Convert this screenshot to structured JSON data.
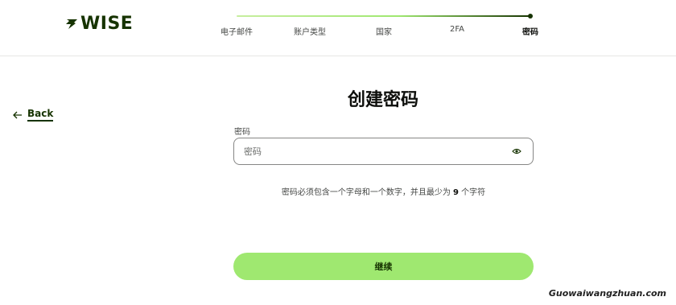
{
  "brand": {
    "logo_text": "WISE",
    "accent": "#9fe870",
    "dark": "#163300"
  },
  "steps": [
    {
      "label": "电子邮件"
    },
    {
      "label": "账户类型"
    },
    {
      "label": "国家"
    },
    {
      "label": "2FA"
    },
    {
      "label": "密码"
    }
  ],
  "back": {
    "label": "Back"
  },
  "main": {
    "title": "创建密码",
    "field_label": "密码",
    "password_placeholder": "密码",
    "password_value": "",
    "hint_before": "密码必须包含一个字母和一个数字，并且最少为",
    "hint_number": "9",
    "hint_after": "个字符",
    "continue_label": "继续"
  },
  "watermark": "Guowaiwangzhuan.com"
}
